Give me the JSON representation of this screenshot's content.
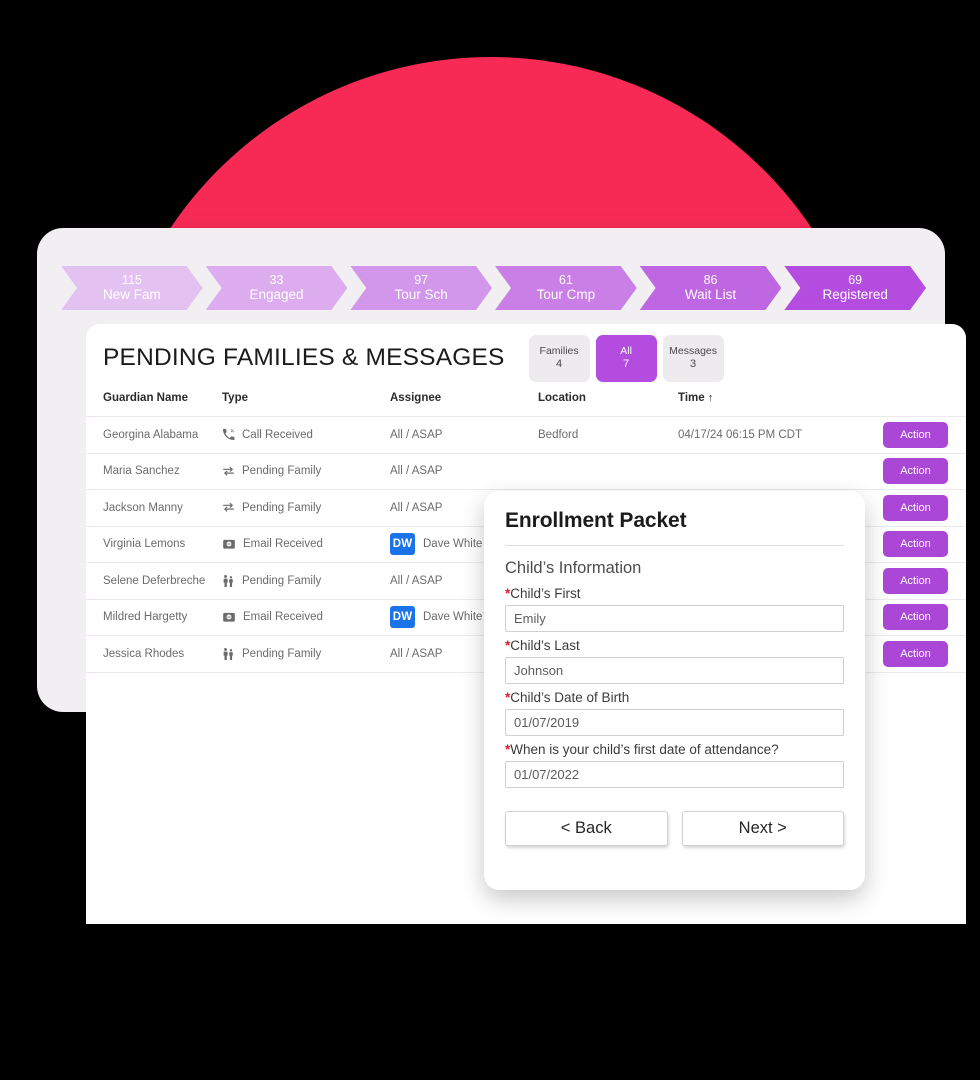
{
  "funnel": {
    "steps": [
      {
        "count": "115",
        "label": "New Fam",
        "color": "#e3c2f2"
      },
      {
        "count": "33",
        "label": "Engaged",
        "color": "#dcacef"
      },
      {
        "count": "97",
        "label": "Tour Sch",
        "color": "#d296ea"
      },
      {
        "count": "61",
        "label": "Tour Cmp",
        "color": "#c97fe6"
      },
      {
        "count": "86",
        "label": "Wait List",
        "color": "#bf66e2"
      },
      {
        "count": "69",
        "label": "Registered",
        "color": "#b44ce0"
      }
    ]
  },
  "panel": {
    "title": "PENDING FAMILIES & MESSAGES",
    "tabs": [
      {
        "label": "Families",
        "count": "4",
        "active": false
      },
      {
        "label": "All",
        "count": "7",
        "active": true
      },
      {
        "label": "Messages",
        "count": "3",
        "active": false
      }
    ],
    "columns": [
      "Guardian Name",
      "Type",
      "Assignee",
      "Location",
      "Time"
    ],
    "sort_indicator": "↑",
    "action_label": "Action",
    "rows": [
      {
        "name": "Georgina Alabama",
        "type": "Call Received",
        "icon": "phone-icon",
        "assignee": "All / ASAP",
        "avatar": "",
        "location": "Bedford",
        "time": "04/17/24 06:15 PM CDT"
      },
      {
        "name": "Maria Sanchez",
        "type": "Pending Family",
        "icon": "swap-icon",
        "assignee": "All / ASAP",
        "avatar": "",
        "location": "",
        "time": ""
      },
      {
        "name": "Jackson Manny",
        "type": "Pending Family",
        "icon": "swap-icon",
        "assignee": "All / ASAP",
        "avatar": "",
        "location": "",
        "time": ""
      },
      {
        "name": "Virginia Lemons",
        "type": "Email Received",
        "icon": "email-icon",
        "assignee": "Dave White",
        "avatar": "DW",
        "location": "",
        "time": ""
      },
      {
        "name": "Selene Deferbreche",
        "type": "Pending Family",
        "icon": "family-icon",
        "assignee": "All / ASAP",
        "avatar": "",
        "location": "",
        "time": ""
      },
      {
        "name": "Mildred Hargetty",
        "type": "Email Received",
        "icon": "email-icon",
        "assignee": "Dave White",
        "avatar": "DW",
        "location": "",
        "time": ""
      },
      {
        "name": "Jessica Rhodes",
        "type": "Pending Family",
        "icon": "family-icon",
        "assignee": "All / ASAP",
        "avatar": "",
        "location": "",
        "time": ""
      }
    ]
  },
  "modal": {
    "title": "Enrollment Packet",
    "subtitle": "Child’s Information",
    "required_marker": "*",
    "fields": [
      {
        "label": "Child’s First",
        "value": "Emily"
      },
      {
        "label": "Child’s Last",
        "value": "Johnson"
      },
      {
        "label": "Child’s Date of Birth",
        "value": "01/07/2019"
      },
      {
        "label": "When is your child’s first date of attendance?",
        "value": "01/07/2022"
      }
    ],
    "back_label": "<  Back",
    "next_label": "Next >"
  },
  "theme": {
    "circle": "#f72a55",
    "accent": "#b44ce0",
    "action": "#ab47d6",
    "avatar": "#1a73e8"
  }
}
